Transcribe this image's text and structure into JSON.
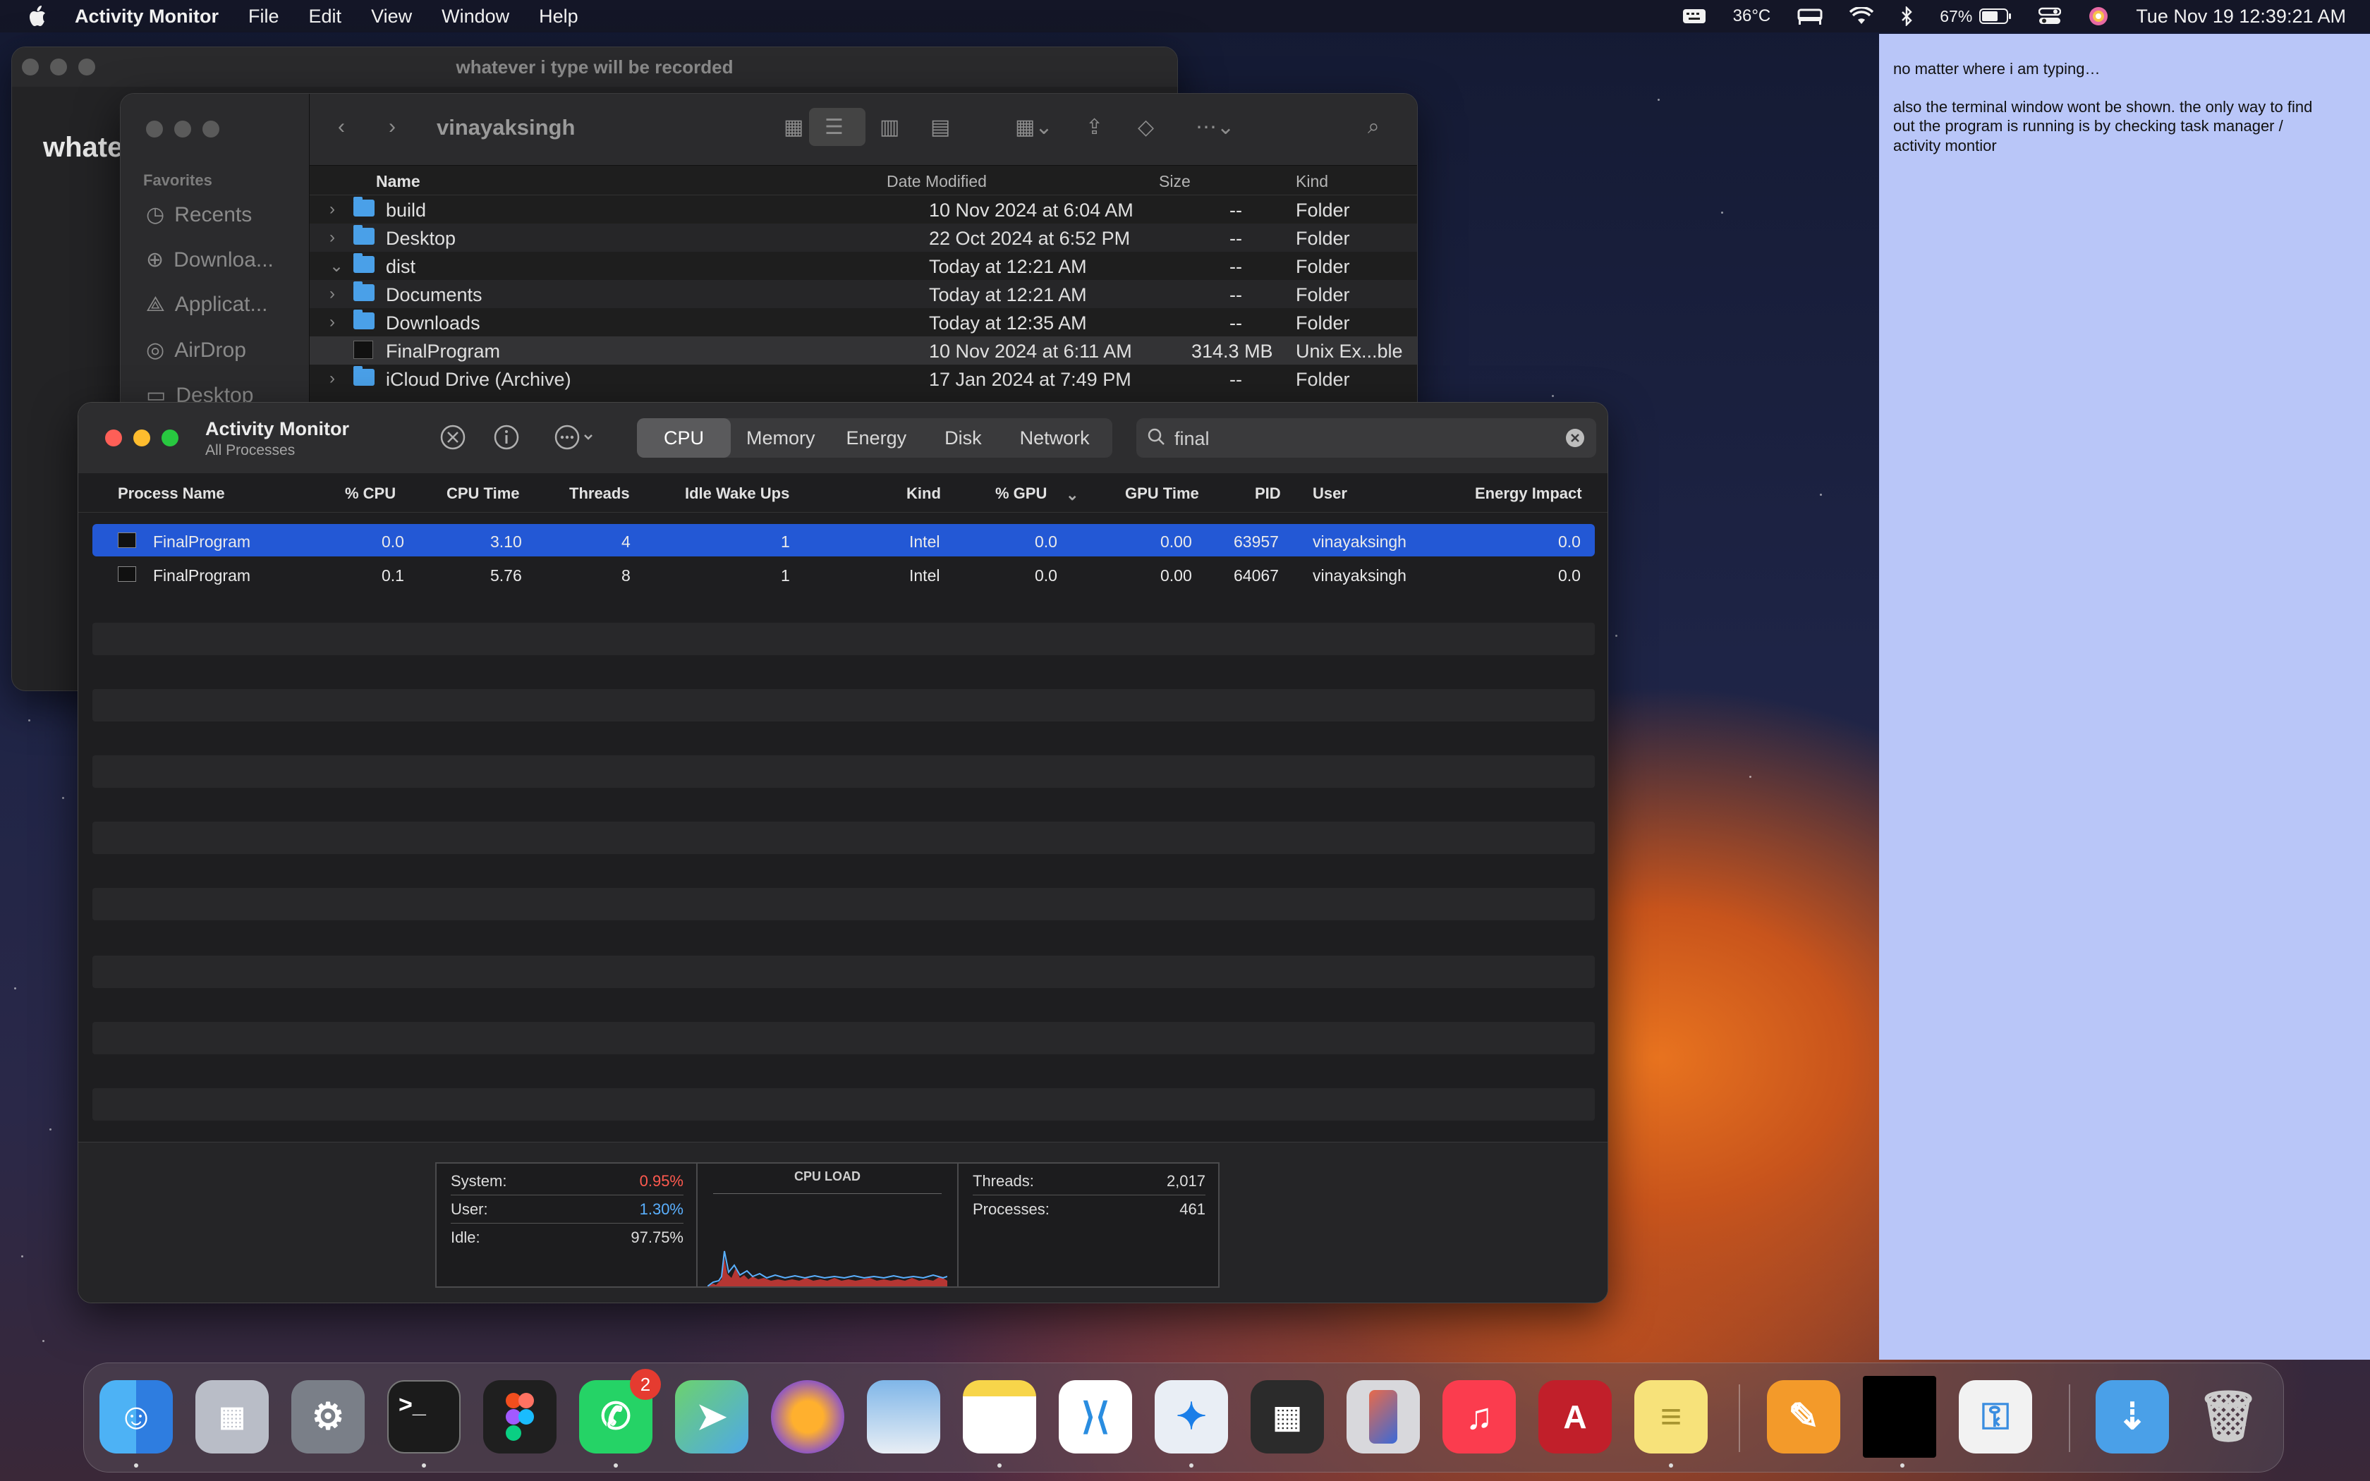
{
  "menubar": {
    "app": "Activity Monitor",
    "items": [
      "File",
      "Edit",
      "View",
      "Window",
      "Help"
    ],
    "temperature": "36°C",
    "battery": "67%",
    "datetime": "Tue Nov 19  12:39:21 AM"
  },
  "back_window": {
    "title": "whatever i type will be recorded",
    "content_text": "whate"
  },
  "finder": {
    "location": "vinayaksingh",
    "sidebar_heading": "Favorites",
    "sidebar_items": [
      "Recents",
      "Downloa...",
      "Applicat...",
      "AirDrop",
      "Desktop"
    ],
    "columns": {
      "name": "Name",
      "date": "Date Modified",
      "size": "Size",
      "kind": "Kind"
    },
    "rows": [
      {
        "name": "build",
        "date": "10 Nov 2024 at 6:04 AM",
        "size": "--",
        "kind": "Folder",
        "chevron": "›"
      },
      {
        "name": "Desktop",
        "date": "22 Oct 2024 at 6:52 PM",
        "size": "--",
        "kind": "Folder",
        "chevron": "›"
      },
      {
        "name": "dist",
        "date": "Today at 12:21 AM",
        "size": "--",
        "kind": "Folder",
        "chevron": "⌄"
      },
      {
        "name": "Documents",
        "date": "Today at 12:21 AM",
        "size": "--",
        "kind": "Folder",
        "chevron": "›"
      },
      {
        "name": "Downloads",
        "date": "Today at 12:35 AM",
        "size": "--",
        "kind": "Folder",
        "chevron": "›"
      },
      {
        "name": "FinalProgram",
        "date": "10 Nov 2024 at 6:11 AM",
        "size": "314.3 MB",
        "kind": "Unix Ex...ble",
        "chevron": ""
      },
      {
        "name": "iCloud Drive (Archive)",
        "date": "17 Jan 2024 at 7:49 PM",
        "size": "--",
        "kind": "Folder",
        "chevron": "›"
      }
    ]
  },
  "activity_monitor": {
    "title": "Activity Monitor",
    "subtitle": "All Processes",
    "tabs": [
      "CPU",
      "Memory",
      "Energy",
      "Disk",
      "Network"
    ],
    "active_tab": "CPU",
    "search_value": "final",
    "columns": {
      "process_name": "Process Name",
      "cpu": "% CPU",
      "cpu_time": "CPU Time",
      "threads": "Threads",
      "idle_wake_ups": "Idle Wake Ups",
      "kind": "Kind",
      "gpu": "% GPU",
      "gpu_time": "GPU Time",
      "pid": "PID",
      "user": "User",
      "energy": "Energy Impact"
    },
    "processes": [
      {
        "name": "FinalProgram",
        "cpu": "0.0",
        "cpu_time": "3.10",
        "threads": "4",
        "idle": "1",
        "kind": "Intel",
        "gpu": "0.0",
        "gpu_time": "0.00",
        "pid": "63957",
        "user": "vinayaksingh",
        "energy": "0.0"
      },
      {
        "name": "FinalProgram",
        "cpu": "0.1",
        "cpu_time": "5.76",
        "threads": "8",
        "idle": "1",
        "kind": "Intel",
        "gpu": "0.0",
        "gpu_time": "0.00",
        "pid": "64067",
        "user": "vinayaksingh",
        "energy": "0.0"
      }
    ],
    "stats": {
      "system_label": "System:",
      "system_value": "0.95%",
      "user_label": "User:",
      "user_value": "1.30%",
      "idle_label": "Idle:",
      "idle_value": "97.75%",
      "cpu_load_label": "CPU LOAD",
      "threads_label": "Threads:",
      "threads_value": "2,017",
      "processes_label": "Processes:",
      "processes_value": "461"
    },
    "colors": {
      "system": "#ff5a4f",
      "user": "#5ab0ff",
      "selection": "#2358d5"
    }
  },
  "note": {
    "line1": "no matter where i am typing…",
    "line2": "also the terminal window wont be shown. the only way to find out the program is running is by checking task manager / activity montior"
  },
  "dock": {
    "apps": [
      "finder-icon",
      "launchpad-icon",
      "system-settings-icon",
      "terminal-icon",
      "figma-icon",
      "whatsapp-icon",
      "maps-icon",
      "firefox-icon",
      "preview-icon",
      "notes-icon",
      "vscode-icon",
      "safari-icon",
      "calculator-icon",
      "iphone-mirroring-icon",
      "music-icon",
      "autocad-lt-icon",
      "stickies-icon",
      "pages-icon",
      "terminal-window-icon",
      "passwords-icon",
      "downloads-folder-icon",
      "trash-icon"
    ],
    "whatsapp_badge": "2"
  }
}
